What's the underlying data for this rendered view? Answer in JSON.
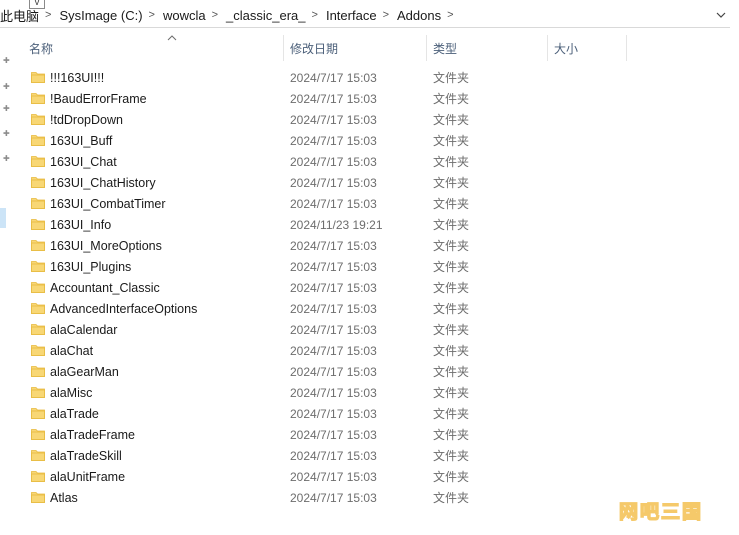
{
  "address": {
    "crumbs": [
      "此电脑",
      "SysImage (C:)",
      "wowcla",
      "_classic_era_",
      "Interface",
      "Addons"
    ],
    "tiny_chevron": "v"
  },
  "columns": {
    "name": "名称",
    "date": "修改日期",
    "type": "类型",
    "size": "大小"
  },
  "files": [
    {
      "name": "!!!163UI!!!",
      "date": "2024/7/17 15:03",
      "type": "文件夹"
    },
    {
      "name": "!BaudErrorFrame",
      "date": "2024/7/17 15:03",
      "type": "文件夹"
    },
    {
      "name": "!tdDropDown",
      "date": "2024/7/17 15:03",
      "type": "文件夹"
    },
    {
      "name": "163UI_Buff",
      "date": "2024/7/17 15:03",
      "type": "文件夹"
    },
    {
      "name": "163UI_Chat",
      "date": "2024/7/17 15:03",
      "type": "文件夹"
    },
    {
      "name": "163UI_ChatHistory",
      "date": "2024/7/17 15:03",
      "type": "文件夹"
    },
    {
      "name": "163UI_CombatTimer",
      "date": "2024/7/17 15:03",
      "type": "文件夹"
    },
    {
      "name": "163UI_Info",
      "date": "2024/11/23 19:21",
      "type": "文件夹"
    },
    {
      "name": "163UI_MoreOptions",
      "date": "2024/7/17 15:03",
      "type": "文件夹"
    },
    {
      "name": "163UI_Plugins",
      "date": "2024/7/17 15:03",
      "type": "文件夹"
    },
    {
      "name": "Accountant_Classic",
      "date": "2024/7/17 15:03",
      "type": "文件夹"
    },
    {
      "name": "AdvancedInterfaceOptions",
      "date": "2024/7/17 15:03",
      "type": "文件夹"
    },
    {
      "name": "alaCalendar",
      "date": "2024/7/17 15:03",
      "type": "文件夹"
    },
    {
      "name": "alaChat",
      "date": "2024/7/17 15:03",
      "type": "文件夹"
    },
    {
      "name": "alaGearMan",
      "date": "2024/7/17 15:03",
      "type": "文件夹"
    },
    {
      "name": "alaMisc",
      "date": "2024/7/17 15:03",
      "type": "文件夹"
    },
    {
      "name": "alaTrade",
      "date": "2024/7/17 15:03",
      "type": "文件夹"
    },
    {
      "name": "alaTradeFrame",
      "date": "2024/7/17 15:03",
      "type": "文件夹"
    },
    {
      "name": "alaTradeSkill",
      "date": "2024/7/17 15:03",
      "type": "文件夹"
    },
    {
      "name": "alaUnitFrame",
      "date": "2024/7/17 15:03",
      "type": "文件夹"
    },
    {
      "name": "Atlas",
      "date": "2024/7/17 15:03",
      "type": "文件夹"
    }
  ],
  "watermark": {
    "text": "网吧三国"
  },
  "colors": {
    "folder": "#f8d775",
    "folder_dark": "#e7b93c",
    "header_text": "#4c607a",
    "muted_text": "#6d6d6d",
    "watermark": "#f5c96a"
  },
  "icons": {
    "folder": "folder-icon",
    "sort": "sort-up-icon",
    "dropdown": "chevron-down-icon",
    "separator": "chevron-right-icon",
    "pin": "pin-icon"
  }
}
